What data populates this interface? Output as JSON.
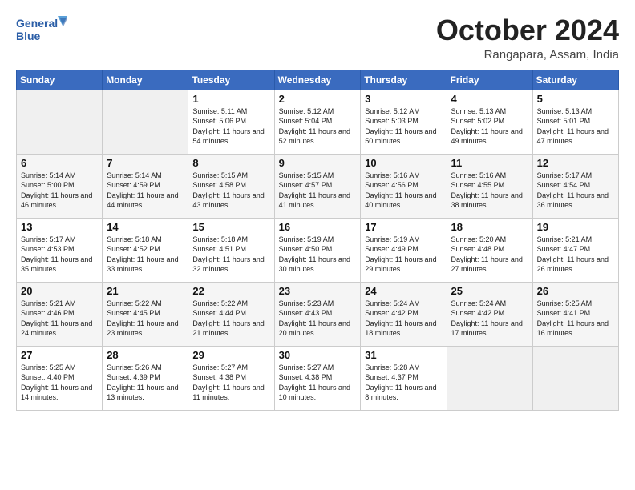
{
  "header": {
    "logo_line1": "General",
    "logo_line2": "Blue",
    "month_title": "October 2024",
    "location": "Rangapara, Assam, India"
  },
  "weekdays": [
    "Sunday",
    "Monday",
    "Tuesday",
    "Wednesday",
    "Thursday",
    "Friday",
    "Saturday"
  ],
  "weeks": [
    [
      {
        "day": "",
        "info": ""
      },
      {
        "day": "",
        "info": ""
      },
      {
        "day": "1",
        "info": "Sunrise: 5:11 AM\nSunset: 5:06 PM\nDaylight: 11 hours and 54 minutes."
      },
      {
        "day": "2",
        "info": "Sunrise: 5:12 AM\nSunset: 5:04 PM\nDaylight: 11 hours and 52 minutes."
      },
      {
        "day": "3",
        "info": "Sunrise: 5:12 AM\nSunset: 5:03 PM\nDaylight: 11 hours and 50 minutes."
      },
      {
        "day": "4",
        "info": "Sunrise: 5:13 AM\nSunset: 5:02 PM\nDaylight: 11 hours and 49 minutes."
      },
      {
        "day": "5",
        "info": "Sunrise: 5:13 AM\nSunset: 5:01 PM\nDaylight: 11 hours and 47 minutes."
      }
    ],
    [
      {
        "day": "6",
        "info": "Sunrise: 5:14 AM\nSunset: 5:00 PM\nDaylight: 11 hours and 46 minutes."
      },
      {
        "day": "7",
        "info": "Sunrise: 5:14 AM\nSunset: 4:59 PM\nDaylight: 11 hours and 44 minutes."
      },
      {
        "day": "8",
        "info": "Sunrise: 5:15 AM\nSunset: 4:58 PM\nDaylight: 11 hours and 43 minutes."
      },
      {
        "day": "9",
        "info": "Sunrise: 5:15 AM\nSunset: 4:57 PM\nDaylight: 11 hours and 41 minutes."
      },
      {
        "day": "10",
        "info": "Sunrise: 5:16 AM\nSunset: 4:56 PM\nDaylight: 11 hours and 40 minutes."
      },
      {
        "day": "11",
        "info": "Sunrise: 5:16 AM\nSunset: 4:55 PM\nDaylight: 11 hours and 38 minutes."
      },
      {
        "day": "12",
        "info": "Sunrise: 5:17 AM\nSunset: 4:54 PM\nDaylight: 11 hours and 36 minutes."
      }
    ],
    [
      {
        "day": "13",
        "info": "Sunrise: 5:17 AM\nSunset: 4:53 PM\nDaylight: 11 hours and 35 minutes."
      },
      {
        "day": "14",
        "info": "Sunrise: 5:18 AM\nSunset: 4:52 PM\nDaylight: 11 hours and 33 minutes."
      },
      {
        "day": "15",
        "info": "Sunrise: 5:18 AM\nSunset: 4:51 PM\nDaylight: 11 hours and 32 minutes."
      },
      {
        "day": "16",
        "info": "Sunrise: 5:19 AM\nSunset: 4:50 PM\nDaylight: 11 hours and 30 minutes."
      },
      {
        "day": "17",
        "info": "Sunrise: 5:19 AM\nSunset: 4:49 PM\nDaylight: 11 hours and 29 minutes."
      },
      {
        "day": "18",
        "info": "Sunrise: 5:20 AM\nSunset: 4:48 PM\nDaylight: 11 hours and 27 minutes."
      },
      {
        "day": "19",
        "info": "Sunrise: 5:21 AM\nSunset: 4:47 PM\nDaylight: 11 hours and 26 minutes."
      }
    ],
    [
      {
        "day": "20",
        "info": "Sunrise: 5:21 AM\nSunset: 4:46 PM\nDaylight: 11 hours and 24 minutes."
      },
      {
        "day": "21",
        "info": "Sunrise: 5:22 AM\nSunset: 4:45 PM\nDaylight: 11 hours and 23 minutes."
      },
      {
        "day": "22",
        "info": "Sunrise: 5:22 AM\nSunset: 4:44 PM\nDaylight: 11 hours and 21 minutes."
      },
      {
        "day": "23",
        "info": "Sunrise: 5:23 AM\nSunset: 4:43 PM\nDaylight: 11 hours and 20 minutes."
      },
      {
        "day": "24",
        "info": "Sunrise: 5:24 AM\nSunset: 4:42 PM\nDaylight: 11 hours and 18 minutes."
      },
      {
        "day": "25",
        "info": "Sunrise: 5:24 AM\nSunset: 4:42 PM\nDaylight: 11 hours and 17 minutes."
      },
      {
        "day": "26",
        "info": "Sunrise: 5:25 AM\nSunset: 4:41 PM\nDaylight: 11 hours and 16 minutes."
      }
    ],
    [
      {
        "day": "27",
        "info": "Sunrise: 5:25 AM\nSunset: 4:40 PM\nDaylight: 11 hours and 14 minutes."
      },
      {
        "day": "28",
        "info": "Sunrise: 5:26 AM\nSunset: 4:39 PM\nDaylight: 11 hours and 13 minutes."
      },
      {
        "day": "29",
        "info": "Sunrise: 5:27 AM\nSunset: 4:38 PM\nDaylight: 11 hours and 11 minutes."
      },
      {
        "day": "30",
        "info": "Sunrise: 5:27 AM\nSunset: 4:38 PM\nDaylight: 11 hours and 10 minutes."
      },
      {
        "day": "31",
        "info": "Sunrise: 5:28 AM\nSunset: 4:37 PM\nDaylight: 11 hours and 8 minutes."
      },
      {
        "day": "",
        "info": ""
      },
      {
        "day": "",
        "info": ""
      }
    ]
  ]
}
